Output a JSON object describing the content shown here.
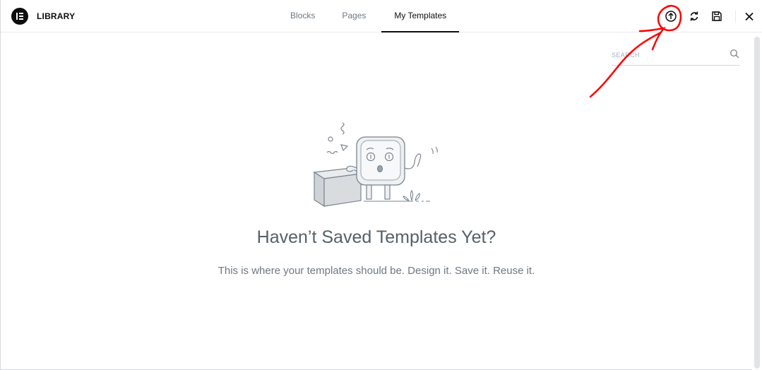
{
  "header": {
    "brand": "LIBRARY",
    "tabs": [
      {
        "label": "Blocks",
        "active": false
      },
      {
        "label": "Pages",
        "active": false
      },
      {
        "label": "My Templates",
        "active": true
      }
    ],
    "tools": [
      "import-icon",
      "sync-icon",
      "save-icon",
      "close-icon"
    ]
  },
  "search": {
    "placeholder": "SEARCH",
    "icon": "search-icon"
  },
  "empty_state": {
    "title": "Haven’t Saved Templates Yet?",
    "message": "This is where your templates should be. Design it. Save it. Reuse it."
  },
  "colors": {
    "primary_text": "#0c0d0e",
    "secondary_text": "#6d7882",
    "annotation": "#ff0000"
  }
}
